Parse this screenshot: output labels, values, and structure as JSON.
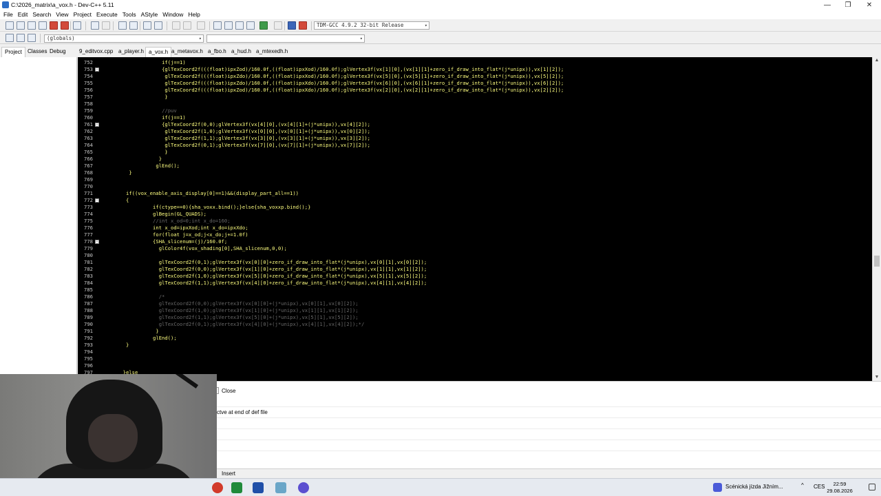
{
  "window": {
    "title": "C:\\2026_matrix\\a_vox.h - Dev-C++ 5.11",
    "controls": [
      "—",
      "❐",
      "✕"
    ]
  },
  "menu": [
    "File",
    "Edit",
    "Search",
    "View",
    "Project",
    "Execute",
    "Tools",
    "AStyle",
    "Window",
    "Help"
  ],
  "toolbar": {
    "compiler": "TDM-GCC 4.9.2 32-bit Release",
    "scope": "(globals)",
    "scope2": ""
  },
  "left_tabs": [
    "Project",
    "Classes",
    "Debug"
  ],
  "file_tabs": [
    "9_editvox.cpp",
    "a_player.h",
    "a_vox.h",
    "a_metavox.h",
    "a_fbo.h",
    "a_hud.h",
    "a_mtexedh.h"
  ],
  "active_file_tab": 2,
  "code_lines": [
    {
      "n": "752",
      "indent": 24,
      "text": "if(j==1)",
      "fold": false,
      "comment": false
    },
    {
      "n": "753",
      "indent": 24,
      "text": "{glTexCoord2f(((float)ipxZod)/160.0f,((float)ipxXod)/160.0f);glVertex3f(vx[1][0],(vx[1][1]+zero_if_draw_into_flat*(j*unipx)),vx[1][2]);",
      "fold": true,
      "comment": false
    },
    {
      "n": "754",
      "indent": 26,
      "text": "glTexCoord2f(((float)ipxZdo)/160.0f,((float)ipxXod)/160.0f);glVertex3f(vx[5][0],(vx[5][1]+zero_if_draw_into_flat*(j*unipx)),vx[5][2]);",
      "fold": false,
      "comment": false
    },
    {
      "n": "755",
      "indent": 26,
      "text": "glTexCoord2f(((float)ipxZdo)/160.0f,((float)ipxXdo)/160.0f);glVertex3f(vx[6][0],(vx[6][1]+zero_if_draw_into_flat*(j*unipx)),vx[6][2]);",
      "fold": false,
      "comment": false
    },
    {
      "n": "756",
      "indent": 26,
      "text": "glTexCoord2f(((float)ipxZod)/160.0f,((float)ipxXdo)/160.0f);glVertex3f(vx[2][0],(vx[2][1]+zero_if_draw_into_flat*(j*unipx)),vx[2][2]);",
      "fold": false,
      "comment": false
    },
    {
      "n": "757",
      "indent": 26,
      "text": "}",
      "fold": false,
      "comment": false
    },
    {
      "n": "758",
      "indent": 0,
      "text": "",
      "fold": false,
      "comment": false
    },
    {
      "n": "759",
      "indent": 24,
      "text": "//puv",
      "fold": false,
      "comment": true
    },
    {
      "n": "760",
      "indent": 24,
      "text": "if(j==1)",
      "fold": false,
      "comment": false
    },
    {
      "n": "761",
      "indent": 24,
      "text": "{glTexCoord2f(0,0);glVertex3f(vx[4][0],(vx[4][1]+(j*unipx)),vx[4][2]);",
      "fold": true,
      "comment": false
    },
    {
      "n": "762",
      "indent": 26,
      "text": "glTexCoord2f(1,0);glVertex3f(vx[0][0],(vx[0][1]+(j*unipx)),vx[0][2]);",
      "fold": false,
      "comment": false
    },
    {
      "n": "763",
      "indent": 26,
      "text": "glTexCoord2f(1,1);glVertex3f(vx[3][0],(vx[3][1]+(j*unipx)),vx[3][2]);",
      "fold": false,
      "comment": false
    },
    {
      "n": "764",
      "indent": 26,
      "text": "glTexCoord2f(0,1);glVertex3f(vx[7][0],(vx[7][1]+(j*unipx)),vx[7][2]);",
      "fold": false,
      "comment": false
    },
    {
      "n": "765",
      "indent": 26,
      "text": "}",
      "fold": false,
      "comment": false
    },
    {
      "n": "766",
      "indent": 22,
      "text": "}",
      "fold": false,
      "comment": false
    },
    {
      "n": "767",
      "indent": 20,
      "text": "glEnd();",
      "fold": false,
      "comment": false
    },
    {
      "n": "768",
      "indent": 2,
      "text": "}",
      "fold": false,
      "comment": false
    },
    {
      "n": "769",
      "indent": 0,
      "text": "",
      "fold": false,
      "comment": false
    },
    {
      "n": "770",
      "indent": 0,
      "text": "",
      "fold": false,
      "comment": false
    },
    {
      "n": "771",
      "indent": 0,
      "text": "if((vox_enable_axis_display[0]==1)&&(display_part_all==1))",
      "fold": false,
      "comment": false
    },
    {
      "n": "772",
      "indent": 0,
      "text": "{",
      "fold": true,
      "comment": false
    },
    {
      "n": "773",
      "indent": 18,
      "text": "if(ctype==0){sha_voxx.bind();}else{sha_voxxp.bind();}",
      "fold": false,
      "comment": false
    },
    {
      "n": "774",
      "indent": 18,
      "text": "glBegin(GL_QUADS);",
      "fold": false,
      "comment": false
    },
    {
      "n": "775",
      "indent": 18,
      "text": "//int x_od=0;int x_do=160;",
      "fold": false,
      "comment": true
    },
    {
      "n": "776",
      "indent": 18,
      "text": "int x_od=ipxXod;int x_do=ipxXdo;",
      "fold": false,
      "comment": false
    },
    {
      "n": "777",
      "indent": 18,
      "text": "for(float j=x_od;j<x_do;j+=1.0f)",
      "fold": false,
      "comment": false
    },
    {
      "n": "778",
      "indent": 18,
      "text": "{SHA_slicenum=(j)/160.0f;",
      "fold": true,
      "comment": false
    },
    {
      "n": "779",
      "indent": 22,
      "text": "glColor4f(vox_shading[0],SHA_slicenum,0,0);",
      "fold": false,
      "comment": false
    },
    {
      "n": "780",
      "indent": 0,
      "text": "",
      "fold": false,
      "comment": false
    },
    {
      "n": "781",
      "indent": 22,
      "text": "glTexCoord2f(0,1);glVertex3f(vx[0][0]+zero_if_draw_into_flat*(j*unipx),vx[0][1],vx[0][2]);",
      "fold": false,
      "comment": false
    },
    {
      "n": "782",
      "indent": 22,
      "text": "glTexCoord2f(0,0);glVertex3f(vx[1][0]+zero_if_draw_into_flat*(j*unipx),vx[1][1],vx[1][2]);",
      "fold": false,
      "comment": false
    },
    {
      "n": "783",
      "indent": 22,
      "text": "glTexCoord2f(1,0);glVertex3f(vx[5][0]+zero_if_draw_into_flat*(j*unipx),vx[5][1],vx[5][2]);",
      "fold": false,
      "comment": false
    },
    {
      "n": "784",
      "indent": 22,
      "text": "glTexCoord2f(1,1);glVertex3f(vx[4][0]+zero_if_draw_into_flat*(j*unipx),vx[4][1],vx[4][2]);",
      "fold": false,
      "comment": false
    },
    {
      "n": "785",
      "indent": 0,
      "text": "",
      "fold": false,
      "comment": false
    },
    {
      "n": "786",
      "indent": 22,
      "text": "/*",
      "fold": false,
      "comment": true
    },
    {
      "n": "787",
      "indent": 22,
      "text": "glTexCoord2f(0,0);glVertex3f(vx[0][0]+(j*unipx),vx[0][1],vx[0][2]);",
      "fold": false,
      "comment": true
    },
    {
      "n": "788",
      "indent": 22,
      "text": "glTexCoord2f(1,0);glVertex3f(vx[1][0]+(j*unipx),vx[1][1],vx[1][2]);",
      "fold": false,
      "comment": true
    },
    {
      "n": "789",
      "indent": 22,
      "text": "glTexCoord2f(1,1);glVertex3f(vx[5][0]+(j*unipx),vx[5][1],vx[5][2]);",
      "fold": false,
      "comment": true
    },
    {
      "n": "790",
      "indent": 22,
      "text": "glTexCoord2f(0,1);glVertex3f(vx[4][0]+(j*unipx),vx[4][1],vx[4][2]);*/",
      "fold": false,
      "comment": true
    },
    {
      "n": "791",
      "indent": 20,
      "text": "}",
      "fold": false,
      "comment": false
    },
    {
      "n": "792",
      "indent": 18,
      "text": "glEnd();",
      "fold": false,
      "comment": false
    },
    {
      "n": "793",
      "indent": 0,
      "text": "}",
      "fold": false,
      "comment": false
    },
    {
      "n": "794",
      "indent": 0,
      "text": "",
      "fold": false,
      "comment": false
    },
    {
      "n": "795",
      "indent": 0,
      "text": "",
      "fold": false,
      "comment": false
    },
    {
      "n": "796",
      "indent": 0,
      "text": "",
      "fold": false,
      "comment": false
    },
    {
      "n": "797",
      "indent": -2,
      "text": "}else",
      "fold": false,
      "comment": false
    }
  ],
  "bottom": {
    "close_label": "Close",
    "message": "ctve at end of def file"
  },
  "status": {
    "mode": "Insert"
  },
  "taskbar": {
    "now_playing": "Scénická jízda Jižním...",
    "lang": "CES",
    "time": "22:59",
    "date": "29.08.2026",
    "chevron": "^"
  }
}
